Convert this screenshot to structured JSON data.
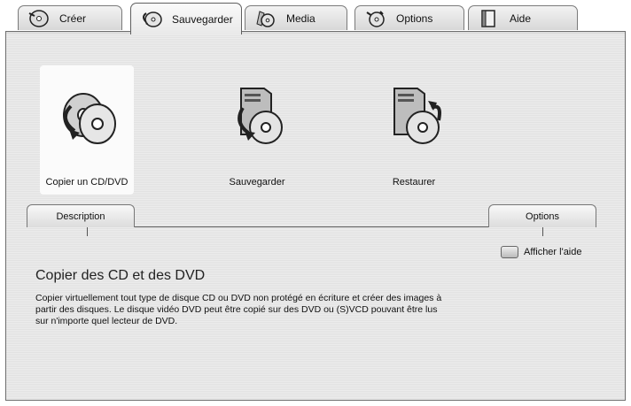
{
  "tabs": [
    {
      "label": "Créer",
      "icon": "create-disc-icon"
    },
    {
      "label": "Sauvegarder",
      "icon": "backup-icon",
      "active": true
    },
    {
      "label": "Media",
      "icon": "media-icon"
    },
    {
      "label": "Options",
      "icon": "options-icon"
    },
    {
      "label": "Aide",
      "icon": "help-book-icon"
    }
  ],
  "actions": [
    {
      "label": "Copier un CD/DVD",
      "icon": "copy-cd-dvd-icon",
      "selected": true
    },
    {
      "label": "Sauvegarder",
      "icon": "backup-server-icon"
    },
    {
      "label": "Restaurer",
      "icon": "restore-server-icon"
    }
  ],
  "subtabs": {
    "description": "Description",
    "options": "Options"
  },
  "help_toggle": {
    "label": "Afficher l'aide"
  },
  "description": {
    "title": "Copier des CD et des DVD",
    "body": "Copier virtuellement tout type de disque CD ou DVD non protégé en écriture et créer des images à partir des disques. Le disque vidéo DVD peut être copié sur des DVD ou (S)VCD pouvant être lus sur n'importe quel lecteur de DVD."
  }
}
